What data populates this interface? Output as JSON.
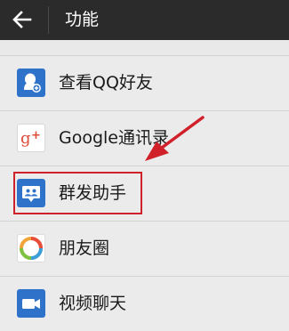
{
  "app_bar": {
    "back_icon": "arrow-left-icon",
    "title": "功能"
  },
  "menu": {
    "items": [
      {
        "label": "查看QQ好友",
        "icon": "qq-friend-icon"
      },
      {
        "label": "Google通讯录",
        "icon": "google-plus-icon"
      },
      {
        "label": "群发助手",
        "icon": "group-message-icon"
      },
      {
        "label": "朋友圈",
        "icon": "moments-icon"
      },
      {
        "label": "视频聊天",
        "icon": "video-chat-icon"
      }
    ]
  },
  "annotation": {
    "highlight_color": "#d0202a",
    "highlighted_item": "群发助手"
  },
  "colors": {
    "app_bar": "#2b2b2b",
    "list_background": "#ebebeb",
    "accent_blue": "#2f72c9",
    "google_red": "#dd4b39"
  }
}
